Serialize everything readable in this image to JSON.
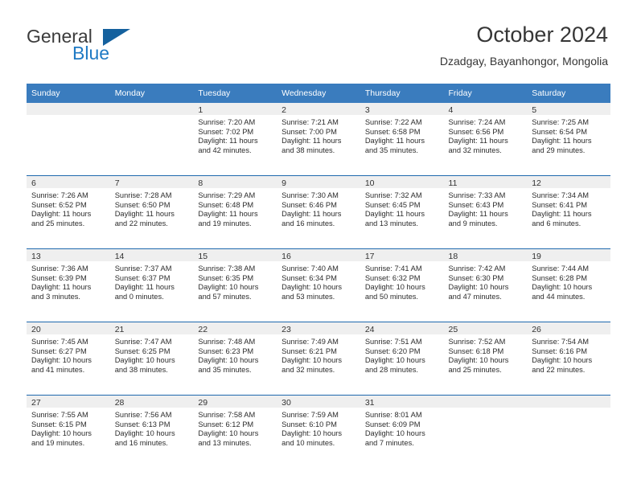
{
  "brand": {
    "word_one": "General",
    "word_two": "Blue",
    "mark": "triangle-icon",
    "color_primary": "#15619e",
    "color_secondary": "#1f7ac4"
  },
  "header": {
    "title": "October 2024",
    "location": "Dzadgay, Bayanhongor, Mongolia"
  },
  "theme": {
    "header_row_bg": "#3a7cbe",
    "daynum_bg": "#efefef",
    "row_divider": "#1f69ae",
    "text": "#2c2c2c"
  },
  "weekdays": [
    "Sunday",
    "Monday",
    "Tuesday",
    "Wednesday",
    "Thursday",
    "Friday",
    "Saturday"
  ],
  "calendar_data": {
    "month": "October",
    "year": 2024,
    "first_weekday_index": 2,
    "days_in_month": 31,
    "labels": {
      "sunrise": "Sunrise:",
      "sunset": "Sunset:",
      "daylight": "Daylight:"
    },
    "weeks": [
      [
        {
          "day": "",
          "empty": true
        },
        {
          "day": "",
          "empty": true
        },
        {
          "day": "1",
          "sunrise": "Sunrise: 7:20 AM",
          "sunset": "Sunset: 7:02 PM",
          "daylight_1": "Daylight: 11 hours",
          "daylight_2": "and 42 minutes."
        },
        {
          "day": "2",
          "sunrise": "Sunrise: 7:21 AM",
          "sunset": "Sunset: 7:00 PM",
          "daylight_1": "Daylight: 11 hours",
          "daylight_2": "and 38 minutes."
        },
        {
          "day": "3",
          "sunrise": "Sunrise: 7:22 AM",
          "sunset": "Sunset: 6:58 PM",
          "daylight_1": "Daylight: 11 hours",
          "daylight_2": "and 35 minutes."
        },
        {
          "day": "4",
          "sunrise": "Sunrise: 7:24 AM",
          "sunset": "Sunset: 6:56 PM",
          "daylight_1": "Daylight: 11 hours",
          "daylight_2": "and 32 minutes."
        },
        {
          "day": "5",
          "sunrise": "Sunrise: 7:25 AM",
          "sunset": "Sunset: 6:54 PM",
          "daylight_1": "Daylight: 11 hours",
          "daylight_2": "and 29 minutes."
        }
      ],
      [
        {
          "day": "6",
          "sunrise": "Sunrise: 7:26 AM",
          "sunset": "Sunset: 6:52 PM",
          "daylight_1": "Daylight: 11 hours",
          "daylight_2": "and 25 minutes."
        },
        {
          "day": "7",
          "sunrise": "Sunrise: 7:28 AM",
          "sunset": "Sunset: 6:50 PM",
          "daylight_1": "Daylight: 11 hours",
          "daylight_2": "and 22 minutes."
        },
        {
          "day": "8",
          "sunrise": "Sunrise: 7:29 AM",
          "sunset": "Sunset: 6:48 PM",
          "daylight_1": "Daylight: 11 hours",
          "daylight_2": "and 19 minutes."
        },
        {
          "day": "9",
          "sunrise": "Sunrise: 7:30 AM",
          "sunset": "Sunset: 6:46 PM",
          "daylight_1": "Daylight: 11 hours",
          "daylight_2": "and 16 minutes."
        },
        {
          "day": "10",
          "sunrise": "Sunrise: 7:32 AM",
          "sunset": "Sunset: 6:45 PM",
          "daylight_1": "Daylight: 11 hours",
          "daylight_2": "and 13 minutes."
        },
        {
          "day": "11",
          "sunrise": "Sunrise: 7:33 AM",
          "sunset": "Sunset: 6:43 PM",
          "daylight_1": "Daylight: 11 hours",
          "daylight_2": "and 9 minutes."
        },
        {
          "day": "12",
          "sunrise": "Sunrise: 7:34 AM",
          "sunset": "Sunset: 6:41 PM",
          "daylight_1": "Daylight: 11 hours",
          "daylight_2": "and 6 minutes."
        }
      ],
      [
        {
          "day": "13",
          "sunrise": "Sunrise: 7:36 AM",
          "sunset": "Sunset: 6:39 PM",
          "daylight_1": "Daylight: 11 hours",
          "daylight_2": "and 3 minutes."
        },
        {
          "day": "14",
          "sunrise": "Sunrise: 7:37 AM",
          "sunset": "Sunset: 6:37 PM",
          "daylight_1": "Daylight: 11 hours",
          "daylight_2": "and 0 minutes."
        },
        {
          "day": "15",
          "sunrise": "Sunrise: 7:38 AM",
          "sunset": "Sunset: 6:35 PM",
          "daylight_1": "Daylight: 10 hours",
          "daylight_2": "and 57 minutes."
        },
        {
          "day": "16",
          "sunrise": "Sunrise: 7:40 AM",
          "sunset": "Sunset: 6:34 PM",
          "daylight_1": "Daylight: 10 hours",
          "daylight_2": "and 53 minutes."
        },
        {
          "day": "17",
          "sunrise": "Sunrise: 7:41 AM",
          "sunset": "Sunset: 6:32 PM",
          "daylight_1": "Daylight: 10 hours",
          "daylight_2": "and 50 minutes."
        },
        {
          "day": "18",
          "sunrise": "Sunrise: 7:42 AM",
          "sunset": "Sunset: 6:30 PM",
          "daylight_1": "Daylight: 10 hours",
          "daylight_2": "and 47 minutes."
        },
        {
          "day": "19",
          "sunrise": "Sunrise: 7:44 AM",
          "sunset": "Sunset: 6:28 PM",
          "daylight_1": "Daylight: 10 hours",
          "daylight_2": "and 44 minutes."
        }
      ],
      [
        {
          "day": "20",
          "sunrise": "Sunrise: 7:45 AM",
          "sunset": "Sunset: 6:27 PM",
          "daylight_1": "Daylight: 10 hours",
          "daylight_2": "and 41 minutes."
        },
        {
          "day": "21",
          "sunrise": "Sunrise: 7:47 AM",
          "sunset": "Sunset: 6:25 PM",
          "daylight_1": "Daylight: 10 hours",
          "daylight_2": "and 38 minutes."
        },
        {
          "day": "22",
          "sunrise": "Sunrise: 7:48 AM",
          "sunset": "Sunset: 6:23 PM",
          "daylight_1": "Daylight: 10 hours",
          "daylight_2": "and 35 minutes."
        },
        {
          "day": "23",
          "sunrise": "Sunrise: 7:49 AM",
          "sunset": "Sunset: 6:21 PM",
          "daylight_1": "Daylight: 10 hours",
          "daylight_2": "and 32 minutes."
        },
        {
          "day": "24",
          "sunrise": "Sunrise: 7:51 AM",
          "sunset": "Sunset: 6:20 PM",
          "daylight_1": "Daylight: 10 hours",
          "daylight_2": "and 28 minutes."
        },
        {
          "day": "25",
          "sunrise": "Sunrise: 7:52 AM",
          "sunset": "Sunset: 6:18 PM",
          "daylight_1": "Daylight: 10 hours",
          "daylight_2": "and 25 minutes."
        },
        {
          "day": "26",
          "sunrise": "Sunrise: 7:54 AM",
          "sunset": "Sunset: 6:16 PM",
          "daylight_1": "Daylight: 10 hours",
          "daylight_2": "and 22 minutes."
        }
      ],
      [
        {
          "day": "27",
          "sunrise": "Sunrise: 7:55 AM",
          "sunset": "Sunset: 6:15 PM",
          "daylight_1": "Daylight: 10 hours",
          "daylight_2": "and 19 minutes."
        },
        {
          "day": "28",
          "sunrise": "Sunrise: 7:56 AM",
          "sunset": "Sunset: 6:13 PM",
          "daylight_1": "Daylight: 10 hours",
          "daylight_2": "and 16 minutes."
        },
        {
          "day": "29",
          "sunrise": "Sunrise: 7:58 AM",
          "sunset": "Sunset: 6:12 PM",
          "daylight_1": "Daylight: 10 hours",
          "daylight_2": "and 13 minutes."
        },
        {
          "day": "30",
          "sunrise": "Sunrise: 7:59 AM",
          "sunset": "Sunset: 6:10 PM",
          "daylight_1": "Daylight: 10 hours",
          "daylight_2": "and 10 minutes."
        },
        {
          "day": "31",
          "sunrise": "Sunrise: 8:01 AM",
          "sunset": "Sunset: 6:09 PM",
          "daylight_1": "Daylight: 10 hours",
          "daylight_2": "and 7 minutes."
        },
        {
          "day": "",
          "empty": true
        },
        {
          "day": "",
          "empty": true
        }
      ]
    ]
  }
}
